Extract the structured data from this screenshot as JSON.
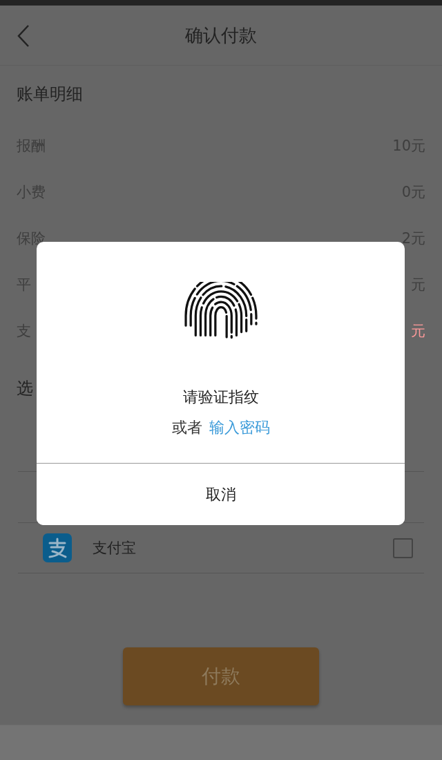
{
  "header": {
    "title": "确认付款"
  },
  "bill": {
    "title": "账单明细",
    "rows": [
      {
        "label": "报酬",
        "value": "10元",
        "highlight": false
      },
      {
        "label": "小费",
        "value": "0元",
        "highlight": false
      },
      {
        "label": "保险",
        "value": "2元",
        "highlight": false
      },
      {
        "label": "平",
        "value": "元",
        "highlight": false
      },
      {
        "label": "支",
        "value": "元",
        "highlight": true
      }
    ]
  },
  "payment": {
    "title": "选",
    "methods": [
      {
        "name": "支付宝",
        "checked": false
      }
    ]
  },
  "pay_button": {
    "label": "付款"
  },
  "dialog": {
    "prompt": "请验证指纹",
    "alt_text": "或者",
    "alt_link": "输入密码",
    "cancel": "取消"
  }
}
